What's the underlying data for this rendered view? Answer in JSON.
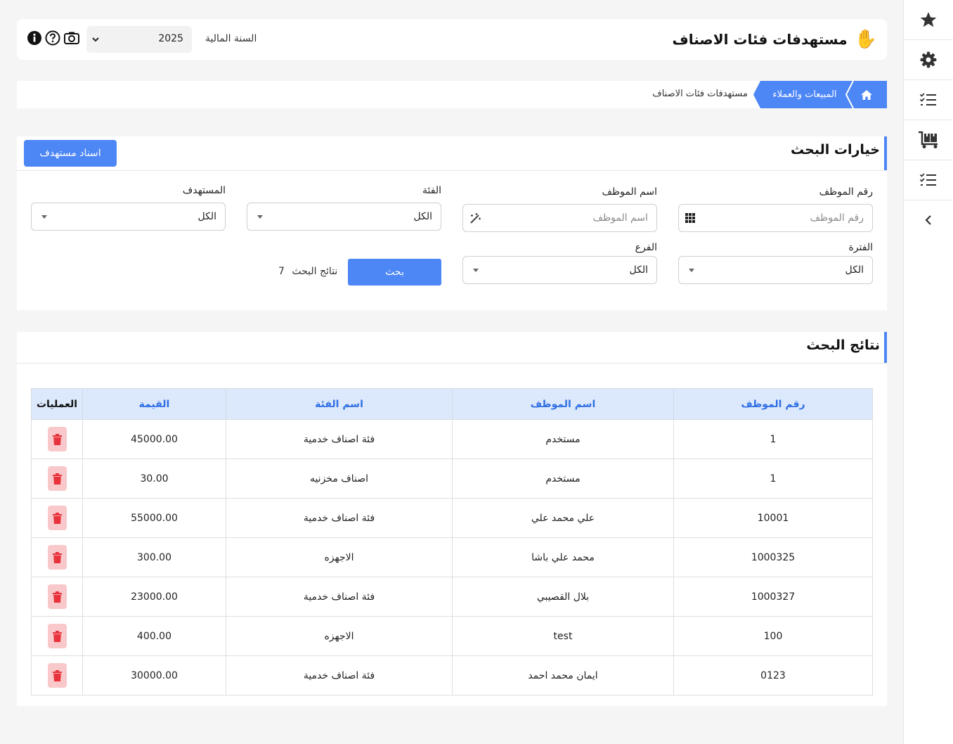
{
  "header": {
    "title": "مستهدفات فئات الاصناف",
    "wave_icon": "waving-hand-icon",
    "fiscal_year_label": "السنة المالية",
    "fiscal_year_value": "2025"
  },
  "breadcrumb": {
    "section": "المبيعات والعملاء",
    "current": "مستهدفات فئات الاصناف"
  },
  "search": {
    "title": "خيارات البحث",
    "assign_button": "اسناد مستهدف",
    "employee_no_label": "رقم الموظف",
    "employee_no_placeholder": "رقم الموظف",
    "employee_name_label": "اسم الموظف",
    "employee_name_placeholder": "اسم الموظف",
    "category_label": "الفئة",
    "category_value": "الكل",
    "target_label": "المستهدف",
    "target_value": "الكل",
    "period_label": "الفترة",
    "period_value": "الكل",
    "branch_label": "الفرع",
    "branch_value": "الكل",
    "search_button": "بحث",
    "results_label": "نتائج البحث",
    "results_count": "7"
  },
  "results": {
    "title": "نتائج البحث",
    "columns": [
      "رقم الموظف",
      "اسم الموظف",
      "اسم الفئة",
      "القيمة",
      "العمليات"
    ],
    "rows": [
      {
        "emp_no": "1",
        "emp_name": "مستخدم",
        "category": "فئة اصناف خدمية",
        "value": "45000.00"
      },
      {
        "emp_no": "1",
        "emp_name": "مستخدم",
        "category": "اصناف مخزنيه",
        "value": "30.00"
      },
      {
        "emp_no": "10001",
        "emp_name": "علي محمد علي",
        "category": "فئة اصناف خدمية",
        "value": "55000.00"
      },
      {
        "emp_no": "1000325",
        "emp_name": "محمد علي باشا",
        "category": "الاجهزه",
        "value": "300.00"
      },
      {
        "emp_no": "1000327",
        "emp_name": "بلال القصيبي",
        "category": "فئة اصناف خدمية",
        "value": "23000.00"
      },
      {
        "emp_no": "100",
        "emp_name": "test",
        "category": "الاجهزه",
        "value": "400.00"
      },
      {
        "emp_no": "0123",
        "emp_name": "ايمان محمد احمد",
        "category": "فئة اصناف خدمية",
        "value": "30000.00"
      }
    ]
  },
  "colors": {
    "accent": "#4d86f5",
    "delete_bg": "#f9c8cb",
    "delete_icon": "#e8323c",
    "table_header_bg": "#dce8fc"
  }
}
